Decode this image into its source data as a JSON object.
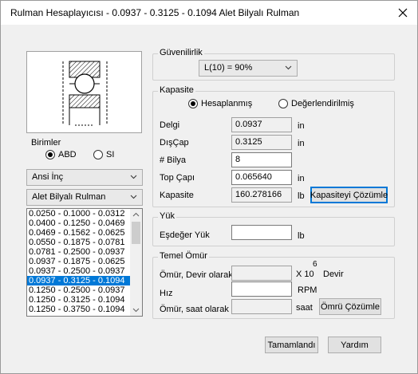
{
  "window": {
    "title": "Rulman Hesaplayıcısı - 0.0937 - 0.3125 - 0.1094 Alet Bilyalı Rulman"
  },
  "units": {
    "group_label": "Birimler",
    "options": [
      "ABD",
      "SI"
    ],
    "selected": "ABD"
  },
  "unit_system_combo": "Ansi İnç",
  "bearing_type_combo": "Alet Bilyalı Rulman",
  "bearing_list": {
    "items": [
      "0.0250 - 0.1000 - 0.0312",
      "0.0400 - 0.1250 - 0.0469",
      "0.0469 - 0.1562 - 0.0625",
      "0.0550 - 0.1875 - 0.0781",
      "0.0781 - 0.2500 - 0.0937",
      "0.0937 - 0.1875 - 0.0625",
      "0.0937 - 0.2500 - 0.0937",
      "0.0937 - 0.3125 - 0.1094",
      "0.1250 - 0.2500 - 0.0937",
      "0.1250 - 0.3125 - 0.1094",
      "0.1250 - 0.3750 - 0.1094"
    ],
    "selected_index": 7
  },
  "reliability": {
    "group_label": "Güvenilirlik",
    "value": "L(10) = 90%"
  },
  "capacity": {
    "group_label": "Kapasite",
    "mode_options": [
      "Hesaplanmış",
      "Değerlendirilmiş"
    ],
    "mode_selected": "Hesaplanmış",
    "bore_label": "Delgi",
    "bore_value": "0.0937",
    "bore_unit": "in",
    "od_label": "DışÇap",
    "od_value": "0.3125",
    "od_unit": "in",
    "balls_label": "# Bilya",
    "balls_value": "8",
    "ball_dia_label": "Top Çapı",
    "ball_dia_value": "0.065640",
    "ball_dia_unit": "in",
    "capacity_label": "Kapasite",
    "capacity_value": "160.278166",
    "capacity_unit": "lb",
    "solve_button": "Kapasiteyi Çözümle"
  },
  "load": {
    "group_label": "Yük",
    "equiv_label": "Eşdeğer Yük",
    "equiv_value": "",
    "equiv_unit": "lb"
  },
  "life": {
    "group_label": "Temel Ömür",
    "revs_label": "Ömür, Devir olarak",
    "revs_value": "",
    "revs_unit": "X 10",
    "revs_exp": "6",
    "revs_unit2": "Devir",
    "speed_label": "Hız",
    "speed_value": "",
    "speed_unit": "RPM",
    "hours_label": "Ömür, saat olarak",
    "hours_value": "",
    "hours_unit": "saat",
    "solve_button": "Ömrü Çözümle"
  },
  "footer": {
    "done_button": "Tamamlandı",
    "help_button": "Yardım"
  },
  "colors": {
    "selection": "#0078d7",
    "default_button_border": "#0078d7"
  },
  "icons": [
    "close-icon",
    "bearing-diagram",
    "chevron-down-icon"
  ]
}
